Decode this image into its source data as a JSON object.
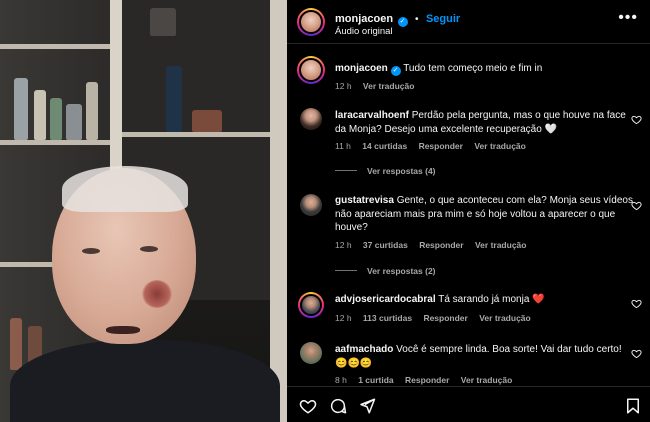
{
  "post": {
    "username": "monjacoen",
    "follow_label": "Seguir",
    "audio": "Áudio original",
    "more_icon": "more-horizontal-icon"
  },
  "caption": {
    "username": "monjacoen",
    "text": "Tudo tem começo meio e fim in",
    "time": "12 h",
    "translate": "Ver tradução"
  },
  "comments": [
    {
      "username": "laracarvalhoenf",
      "text": "Perdão pela pergunta, mas o que houve na face da Monja? Desejo uma excelente recuperação 🤍",
      "time": "11 h",
      "likes": "14 curtidas",
      "reply": "Responder",
      "translate": "Ver tradução",
      "replies": "Ver respostas (4)"
    },
    {
      "username": "gustatrevisa",
      "text": "Gente, o que aconteceu com ela? Monja seus vídeos não apareciam mais pra mim e só hoje voltou a aparecer o que houve?",
      "time": "12 h",
      "likes": "37 curtidas",
      "reply": "Responder",
      "translate": "Ver tradução",
      "replies": "Ver respostas (2)"
    },
    {
      "username": "advjosericardocabral",
      "text": "Tá sarando já monja ❤️",
      "time": "12 h",
      "likes": "113 curtidas",
      "reply": "Responder",
      "translate": "Ver tradução"
    },
    {
      "username": "aafmachado",
      "text": "Você é sempre linda. Boa sorte! Vai dar tudo certo! 😊😊😊",
      "time": "8 h",
      "likes": "1 curtida",
      "reply": "Responder",
      "translate": "Ver tradução"
    }
  ],
  "actions": {
    "like_icon": "heart-icon",
    "comment_icon": "comment-icon",
    "share_icon": "share-icon",
    "save_icon": "bookmark-icon"
  },
  "colors": {
    "accent": "#0095f6",
    "like_red": "#ff3040",
    "muted": "#a8a8a8"
  }
}
